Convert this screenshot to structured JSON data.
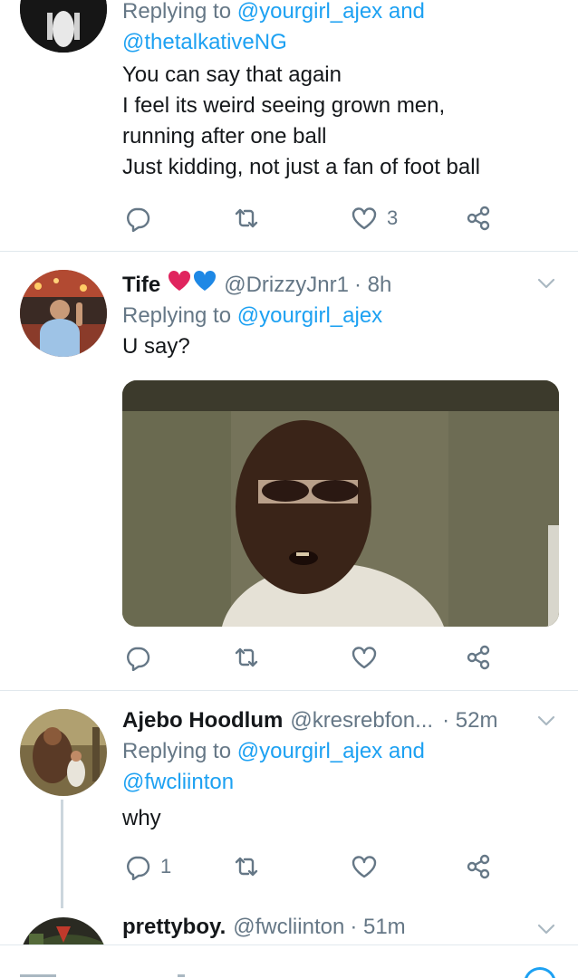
{
  "tweets": [
    {
      "reply_prefix": "Replying to",
      "reply_mention_1": "@yourgirl_ajex",
      "reply_and": "and",
      "reply_mention_2": "@thetalkativeNG",
      "text": [
        "You can say that again",
        "I feel its weird seeing grown men,",
        "running after one ball",
        "Just kidding, not just a fan of foot ball"
      ],
      "likes": "3"
    },
    {
      "name": "Tife",
      "handle": "@DrizzyJnr1",
      "time": "· 8h",
      "reply_prefix": "Replying to",
      "reply_mention_1": "@yourgirl_ajex",
      "text": [
        "U say?"
      ]
    },
    {
      "name": "Ajebo Hoodlum",
      "handle": "@kresrebfon...",
      "time": "· 52m",
      "reply_prefix": "Replying to",
      "reply_mention_1": "@yourgirl_ajex",
      "reply_and": "and",
      "reply_mention_2": "@fwcliinton",
      "text": [
        "why"
      ],
      "replies": "1"
    },
    {
      "name": "prettyboy.",
      "handle": "@fwcliinton",
      "time": "· 51m"
    }
  ],
  "icons": {
    "reply": "reply-icon",
    "retweet": "retweet-icon",
    "like": "heart-icon",
    "share": "share-icon",
    "more": "chevron-down-icon",
    "hearts": [
      "red-heart-emoji",
      "blue-heart-emoji"
    ]
  },
  "colors": {
    "accent": "#1da1f2",
    "secondary_text": "#657786",
    "red_heart": "#e0245e",
    "blue_heart": "#1e88e5"
  }
}
